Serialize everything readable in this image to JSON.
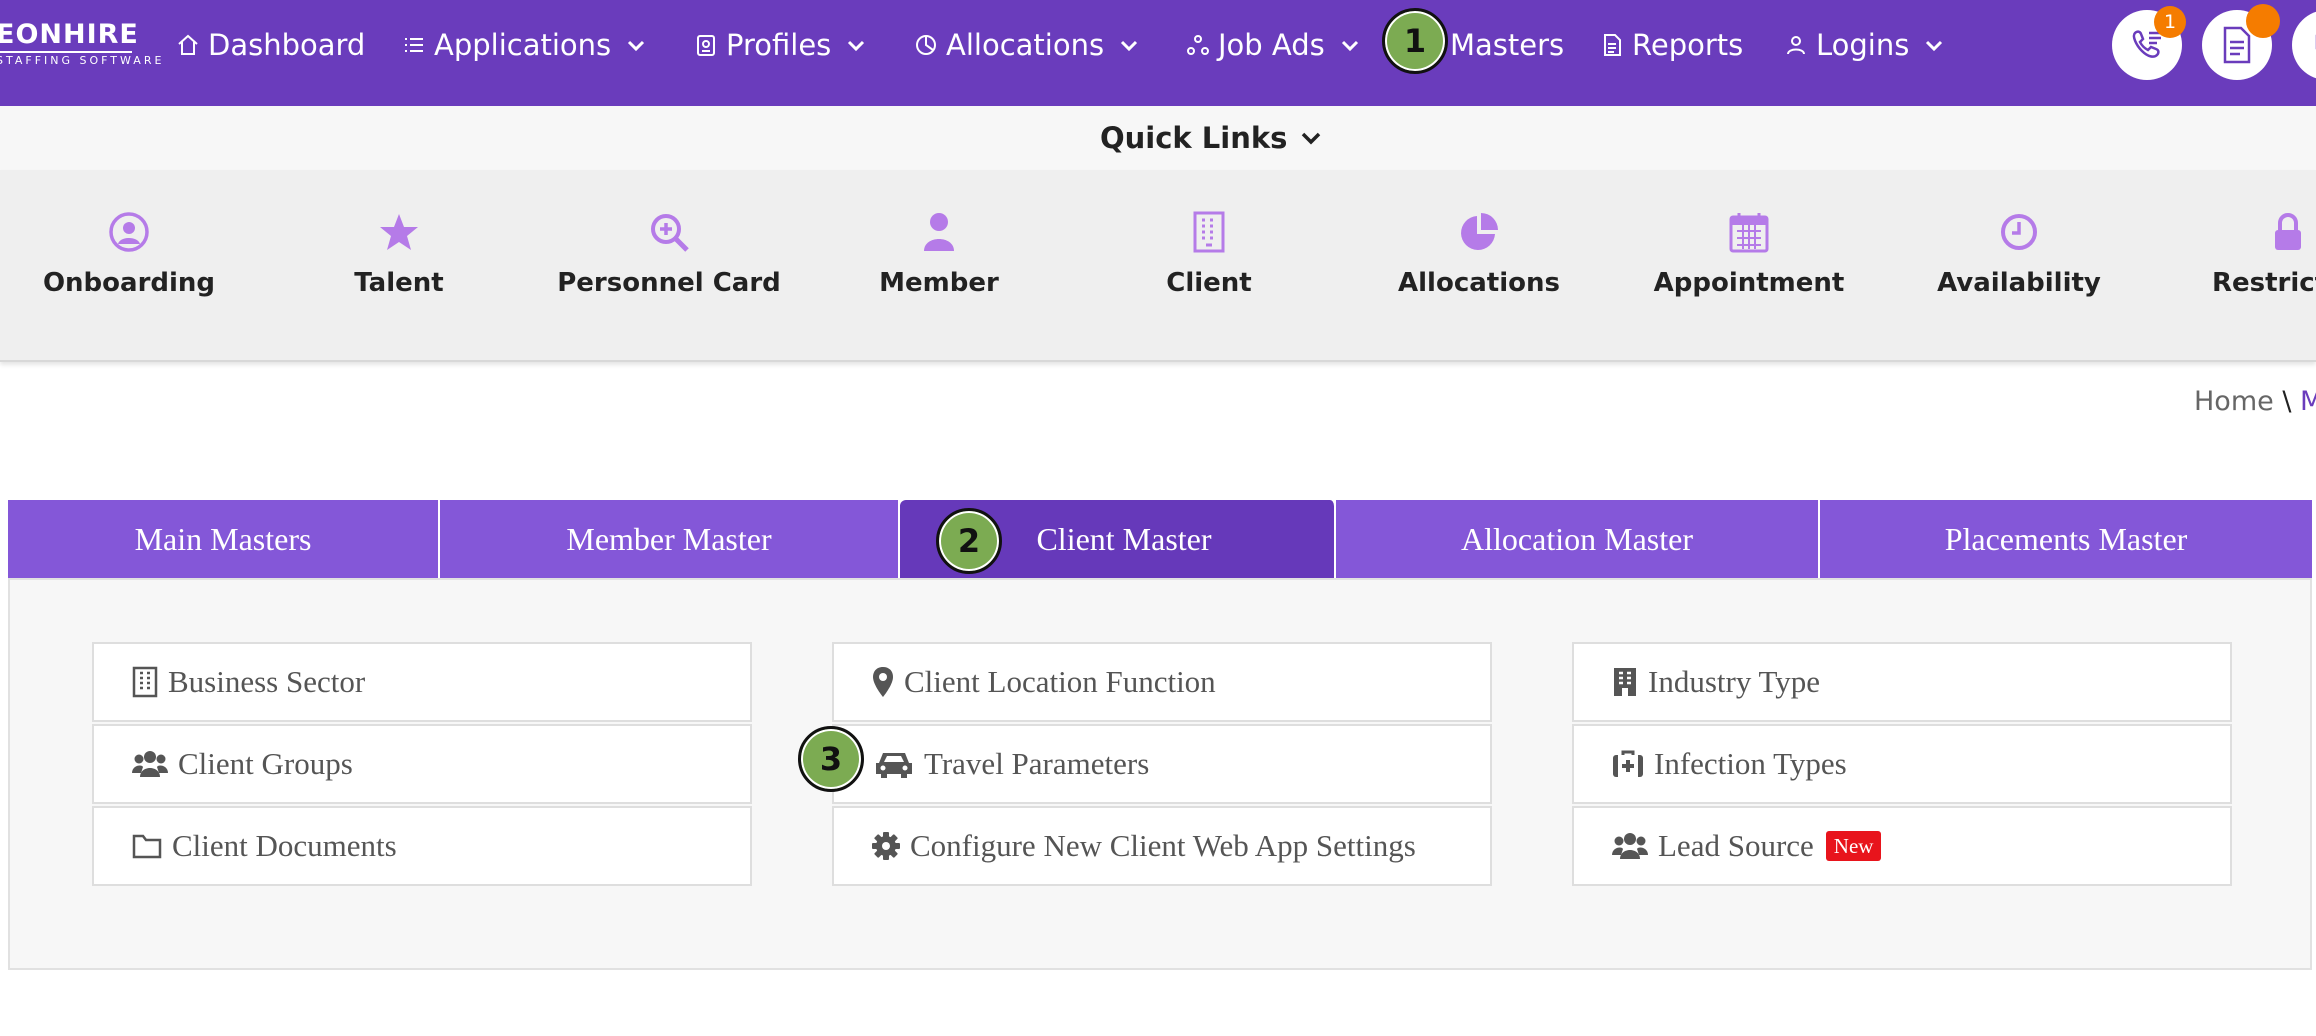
{
  "brand": {
    "name": "EONHIRE",
    "tagline": "STAFFING SOFTWARE"
  },
  "nav": [
    {
      "label": "Dashboard",
      "icon": "home-icon",
      "dropdown": false
    },
    {
      "label": "Applications",
      "icon": "list-icon",
      "dropdown": true
    },
    {
      "label": "Profiles",
      "icon": "id-badge-icon",
      "dropdown": true
    },
    {
      "label": "Allocations",
      "icon": "pie-icon",
      "dropdown": true
    },
    {
      "label": "Job Ads",
      "icon": "network-icon",
      "dropdown": true
    },
    {
      "label": "Masters",
      "icon": "",
      "dropdown": false
    },
    {
      "label": "Reports",
      "icon": "document-icon",
      "dropdown": false
    },
    {
      "label": "Logins",
      "icon": "user-icon",
      "dropdown": true
    }
  ],
  "header_buttons": {
    "calls_badge": "1"
  },
  "quick_links": {
    "title": "Quick Links",
    "items": [
      {
        "label": "Onboarding",
        "icon": "user-circle-icon"
      },
      {
        "label": "Talent",
        "icon": "star-icon"
      },
      {
        "label": "Personnel Card",
        "icon": "zoom-in-icon"
      },
      {
        "label": "Member",
        "icon": "person-icon"
      },
      {
        "label": "Client",
        "icon": "building-icon"
      },
      {
        "label": "Allocations",
        "icon": "pie-chart-icon"
      },
      {
        "label": "Appointment",
        "icon": "calendar-icon"
      },
      {
        "label": "Availability",
        "icon": "clock-icon"
      },
      {
        "label": "Restricti",
        "icon": "lock-icon"
      }
    ]
  },
  "breadcrumb": {
    "home": "Home",
    "sep": "\\",
    "current": "M"
  },
  "tabs": [
    {
      "label": "Main Masters",
      "active": false
    },
    {
      "label": "Member Master",
      "active": false
    },
    {
      "label": "Client Master",
      "active": true
    },
    {
      "label": "Allocation Master",
      "active": false
    },
    {
      "label": "Placements Master",
      "active": false
    }
  ],
  "client_master": [
    {
      "label": "Business Sector",
      "icon": "building-icon"
    },
    {
      "label": "Client Location Function",
      "icon": "map-marker-icon"
    },
    {
      "label": "Industry Type",
      "icon": "building-icon"
    },
    {
      "label": "Client Groups",
      "icon": "users-icon"
    },
    {
      "label": "Travel Parameters",
      "icon": "car-icon"
    },
    {
      "label": "Infection Types",
      "icon": "medkit-icon"
    },
    {
      "label": "Client Documents",
      "icon": "folder-icon"
    },
    {
      "label": "Configure New Client Web App Settings",
      "icon": "gear-icon"
    },
    {
      "label": "Lead Source",
      "icon": "users-icon",
      "badge": "New"
    }
  ],
  "steps": [
    "1",
    "2",
    "3"
  ],
  "colors": {
    "nav_bg": "#6a3cbc",
    "tab_bg": "#8457d8",
    "tab_active": "#6639ba",
    "icon_purple": "#b57be8",
    "step_green": "#7cab52",
    "new_badge": "#e8141c",
    "badge_orange": "#f57c00"
  }
}
